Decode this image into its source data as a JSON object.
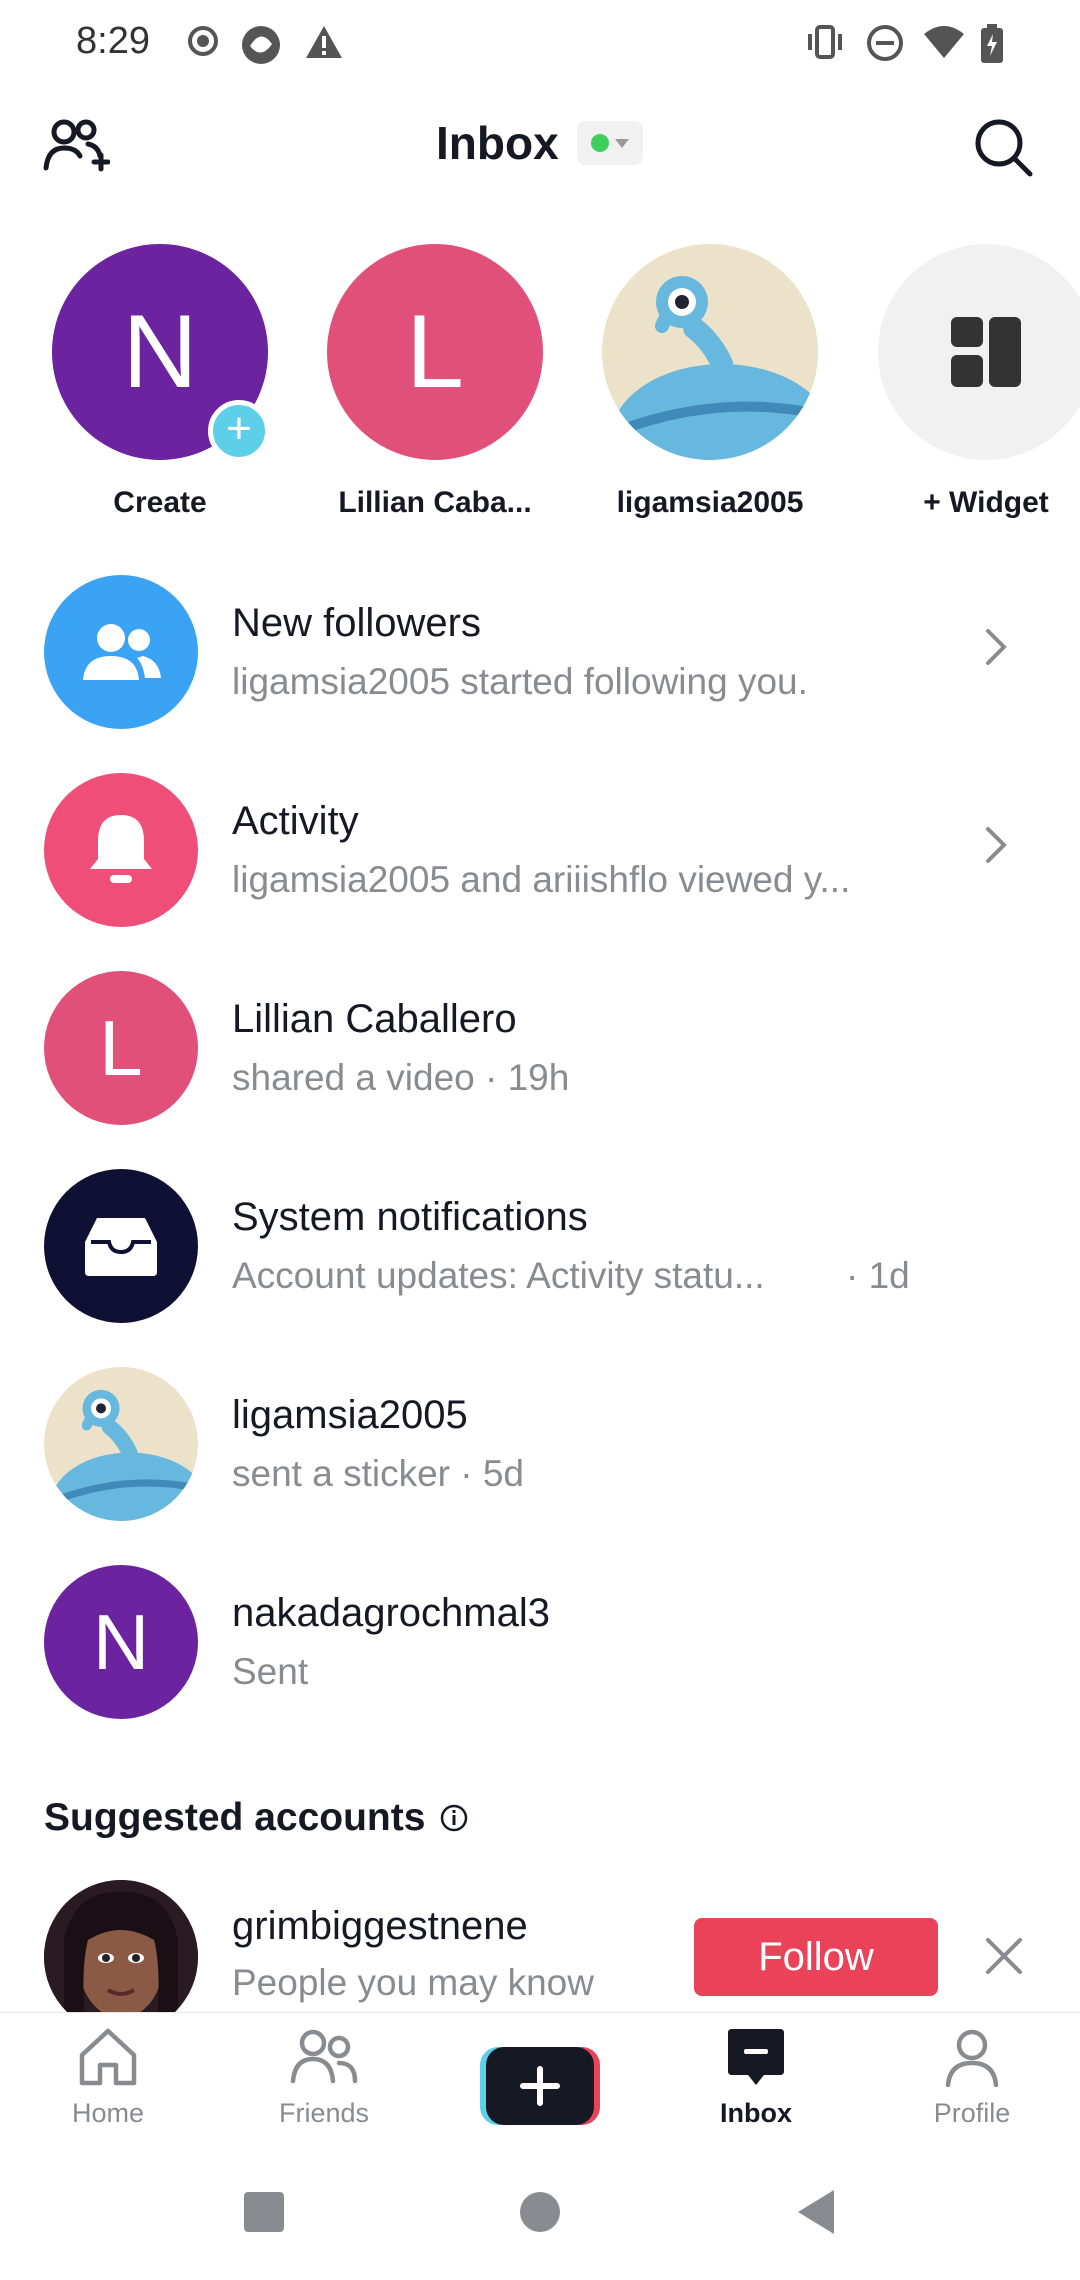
{
  "status_bar": {
    "time": "8:29"
  },
  "header": {
    "title": "Inbox"
  },
  "stories": [
    {
      "label": "Create",
      "initial": "N",
      "color": "#6b23a0"
    },
    {
      "label": "Lillian Caba...",
      "initial": "L",
      "color": "#e0507b"
    },
    {
      "label": "ligamsia2005"
    },
    {
      "label": "+ Widget"
    }
  ],
  "list": [
    {
      "name": "New followers",
      "sub": "ligamsia2005 started following you."
    },
    {
      "name": "Activity",
      "sub": "ligamsia2005 and ariiishflo viewed y..."
    },
    {
      "name": "Lillian Caballero",
      "sub": "shared a video · 19h",
      "initial": "L"
    },
    {
      "name": "System notifications",
      "sub": "Account updates: Activity statu...",
      "time": "· 1d"
    },
    {
      "name": "ligamsia2005",
      "sub": "sent a sticker · 5d"
    },
    {
      "name": "nakadagrochmal3",
      "sub": "Sent",
      "initial": "N"
    }
  ],
  "suggested": {
    "title": "Suggested accounts",
    "account": {
      "name": "grimbiggestnene",
      "sub": "People you may know",
      "follow_label": "Follow"
    }
  },
  "bottom_nav": [
    {
      "label": "Home"
    },
    {
      "label": "Friends"
    },
    {
      "label": "Inbox"
    },
    {
      "label": "Profile"
    }
  ],
  "colors": {
    "accent": "#ea4359",
    "online": "#3ecf5a",
    "blue": "#3aa3f3",
    "pink": "#ee4e78",
    "purple": "#6b23a0",
    "dark": "#0f1033"
  }
}
